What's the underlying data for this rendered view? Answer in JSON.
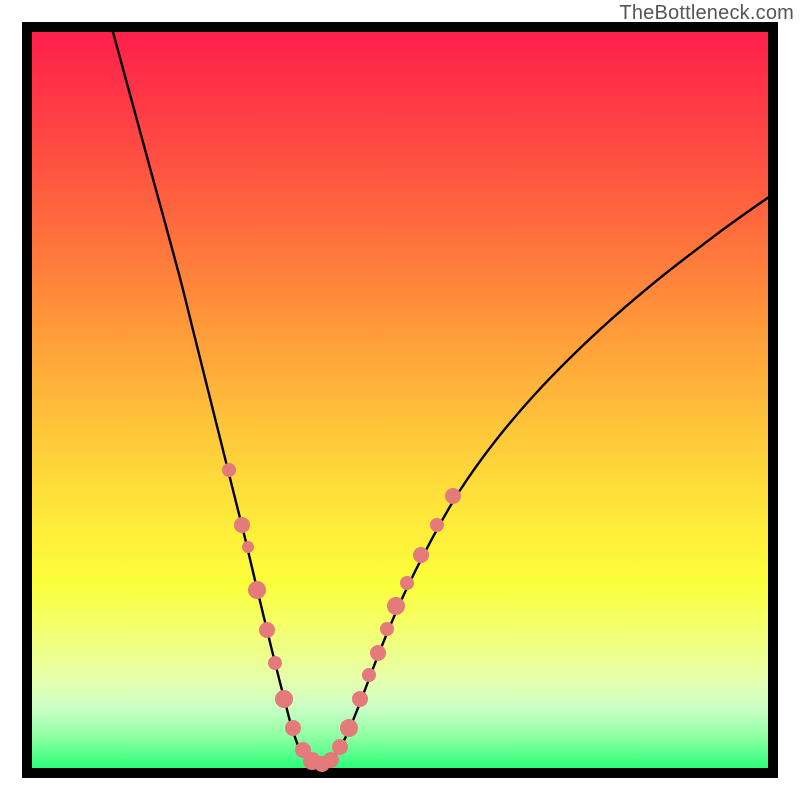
{
  "watermark": "TheBottleneck.com",
  "colors": {
    "frame": "#000000",
    "marker": "#e47a7a",
    "curve": "#000000"
  },
  "chart_data": {
    "type": "line",
    "title": "",
    "xlabel": "",
    "ylabel": "",
    "xlim": [
      0,
      100
    ],
    "ylim": [
      0,
      100
    ],
    "grid": false,
    "legend": false,
    "series": [
      {
        "name": "left-branch",
        "x": [
          11,
          14,
          17,
          20,
          22,
          24,
          26,
          27.5,
          29,
          30.3,
          31.5,
          32.6,
          33.6,
          34.5,
          35.3,
          36.5
        ],
        "y": [
          100,
          89,
          78,
          67,
          59,
          51,
          43,
          37,
          31,
          25.5,
          20.5,
          16,
          12,
          8.5,
          5.5,
          2
        ]
      },
      {
        "name": "valley-floor",
        "x": [
          36.5,
          37.3,
          38.2,
          39.0,
          39.8,
          40.6,
          41.4
        ],
        "y": [
          2,
          1.2,
          0.7,
          0.5,
          0.7,
          1.2,
          2
        ]
      },
      {
        "name": "right-branch",
        "x": [
          41.4,
          43,
          45,
          47.5,
          50.5,
          54,
          58,
          63,
          69,
          76,
          84,
          93,
          100
        ],
        "y": [
          2,
          5,
          10,
          16.5,
          23.5,
          30.5,
          37.5,
          44.5,
          51.5,
          58.5,
          65.5,
          72.5,
          77.5
        ]
      }
    ],
    "markers": [
      {
        "x": 26.8,
        "y": 40.5,
        "r": 7
      },
      {
        "x": 28.6,
        "y": 33.0,
        "r": 8
      },
      {
        "x": 29.3,
        "y": 30.0,
        "r": 6
      },
      {
        "x": 30.6,
        "y": 24.2,
        "r": 9
      },
      {
        "x": 31.9,
        "y": 18.8,
        "r": 8
      },
      {
        "x": 33.0,
        "y": 14.2,
        "r": 7
      },
      {
        "x": 34.3,
        "y": 9.4,
        "r": 9
      },
      {
        "x": 35.5,
        "y": 5.4,
        "r": 8
      },
      {
        "x": 36.8,
        "y": 2.4,
        "r": 8
      },
      {
        "x": 38.1,
        "y": 0.9,
        "r": 9
      },
      {
        "x": 39.4,
        "y": 0.5,
        "r": 8
      },
      {
        "x": 40.6,
        "y": 1.1,
        "r": 8
      },
      {
        "x": 41.8,
        "y": 2.8,
        "r": 8
      },
      {
        "x": 43.1,
        "y": 5.5,
        "r": 9
      },
      {
        "x": 44.6,
        "y": 9.4,
        "r": 8
      },
      {
        "x": 45.8,
        "y": 12.6,
        "r": 7
      },
      {
        "x": 47.0,
        "y": 15.6,
        "r": 8
      },
      {
        "x": 48.3,
        "y": 18.9,
        "r": 7
      },
      {
        "x": 49.5,
        "y": 22.0,
        "r": 9
      },
      {
        "x": 51.0,
        "y": 25.2,
        "r": 7
      },
      {
        "x": 52.8,
        "y": 29.0,
        "r": 8
      },
      {
        "x": 55.0,
        "y": 33.0,
        "r": 7
      },
      {
        "x": 57.2,
        "y": 37.0,
        "r": 8
      }
    ]
  }
}
